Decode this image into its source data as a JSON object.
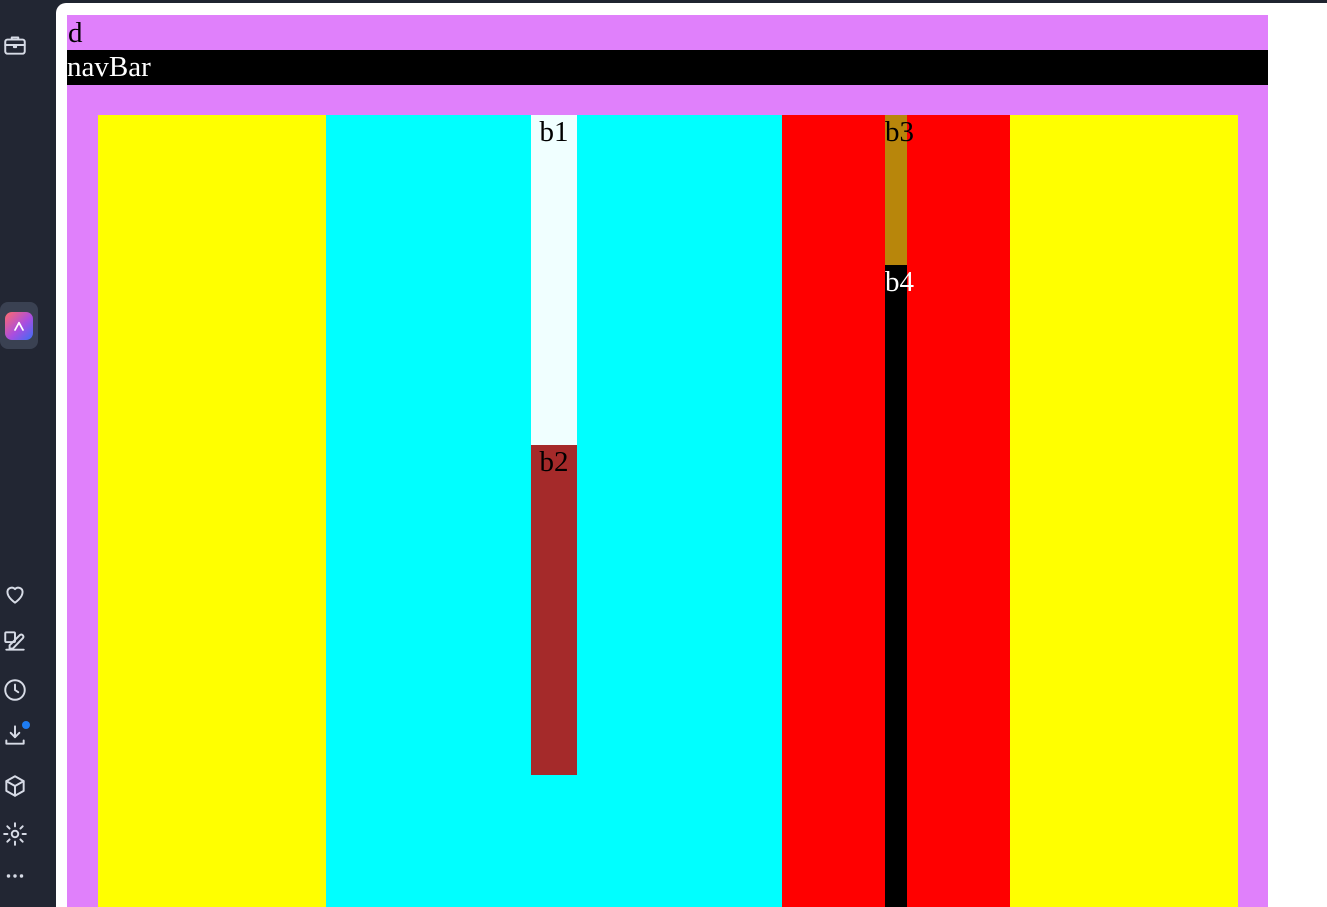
{
  "sidebar": {
    "icons": [
      "briefcase-icon",
      "app-logo-icon",
      "heart-icon",
      "edit-icon",
      "clock-icon",
      "download-icon",
      "cube-icon",
      "gear-icon",
      "more-icon"
    ],
    "download_badge_color": "#1e7cf2"
  },
  "page": {
    "d_label": "d",
    "navbar_label": "navBar",
    "colors": {
      "d_background": "#e080fb",
      "navbar_background": "#000000",
      "outer_columns": "#ffff00",
      "middle_left_column": "#00ffff",
      "middle_right_column": "#ff0000",
      "b1": "#f0ffff",
      "b2": "#a52a2a",
      "b3": "#b8860b",
      "b4": "#000000"
    },
    "boxes": {
      "b1": "b1",
      "b2": "b2",
      "b3": "b3",
      "b4": "b4"
    }
  }
}
